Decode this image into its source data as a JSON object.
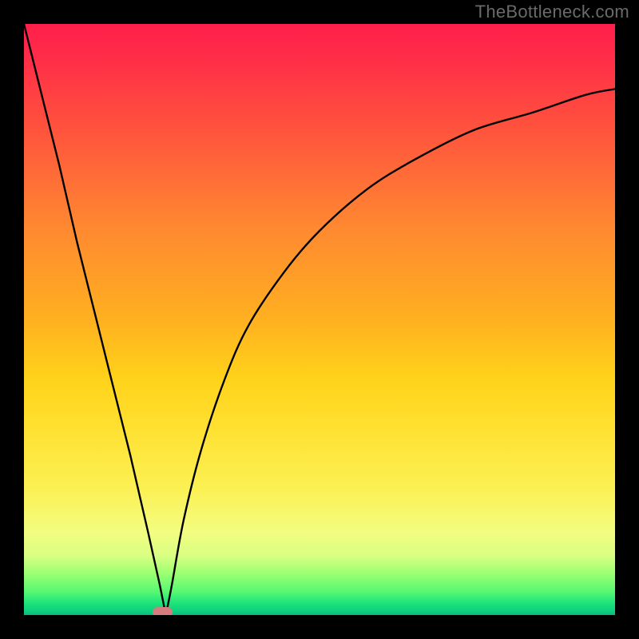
{
  "watermark": "TheBottleneck.com",
  "colors": {
    "background": "#000000",
    "gradient_top": "#ff1f4a",
    "gradient_mid": "#ffd21a",
    "gradient_bottom": "#08b989",
    "curve_stroke": "#000000",
    "marker_fill": "#d57d7e"
  },
  "chart_data": {
    "type": "line",
    "title": "",
    "xlabel": "",
    "ylabel": "",
    "xlim": [
      0,
      100
    ],
    "ylim": [
      0,
      100
    ],
    "grid": false,
    "legend": false,
    "background": "heatmap-gradient-vertical",
    "curve_note": "V-shaped curve: linear descent from top-left to valley near x≈24, then log-like ascent to upper-right",
    "x": [
      0,
      3,
      6,
      9,
      12,
      15,
      18,
      21,
      23,
      24,
      25,
      27,
      30,
      34,
      38,
      44,
      50,
      58,
      66,
      76,
      86,
      95,
      100
    ],
    "y": [
      100,
      88,
      76,
      63,
      51,
      39,
      27,
      14,
      5,
      0,
      5,
      16,
      28,
      40,
      49,
      58,
      65,
      72,
      77,
      82,
      85,
      88,
      89
    ],
    "marker": {
      "x": 23.5,
      "y": 0,
      "shape": "pill"
    }
  }
}
